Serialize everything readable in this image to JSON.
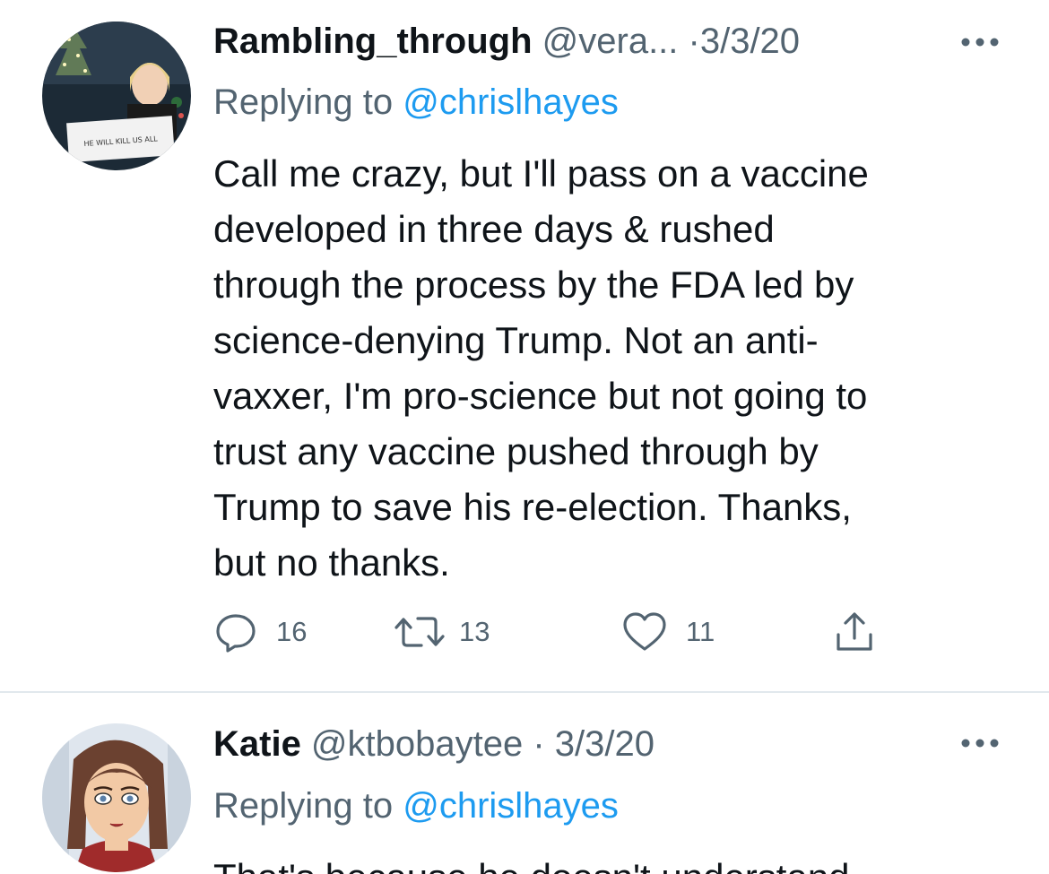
{
  "tweets": [
    {
      "display_name": "Rambling_through",
      "handle_date": " @vera... ·3/3/20",
      "replying_to_label": "Replying to ",
      "replying_to_handle": "@chrislhayes",
      "text": "Call me crazy, but I'll pass on a vaccine developed in three days & rushed through the process by the FDA led by science-denying Trump. Not an anti-vaxxer, I'm pro-science but not going to trust any vaccine pushed through by Trump to save his re-election. Thanks, but no thanks.",
      "text_lines": [
        "Call me crazy, but I'll pass on a vaccine",
        "developed in three days & rushed",
        "through the process by the FDA led by",
        "science-denying Trump. Not an anti-",
        "vaxxer, I'm pro-science but not going to",
        "trust any vaccine pushed through by",
        "Trump to save his re-election. Thanks,",
        "but no thanks."
      ],
      "avatar_sign_text": "HE WILL KILL US ALL",
      "replies": "16",
      "retweets": "13",
      "likes": "11"
    },
    {
      "display_name": "Katie",
      "handle_date": " @ktbobaytee · 3/3/20",
      "replying_to_label": "Replying to ",
      "replying_to_handle": "@chrislhayes",
      "text": "That's because he doesn't understand"
    }
  ],
  "icons": {
    "more": "more-icon",
    "reply": "reply-icon",
    "retweet": "retweet-icon",
    "like": "heart-icon",
    "share": "share-icon"
  },
  "colors": {
    "text_primary": "#0f1419",
    "text_secondary": "#536471",
    "link": "#1d9bf0",
    "divider": "#e1e8ed"
  }
}
